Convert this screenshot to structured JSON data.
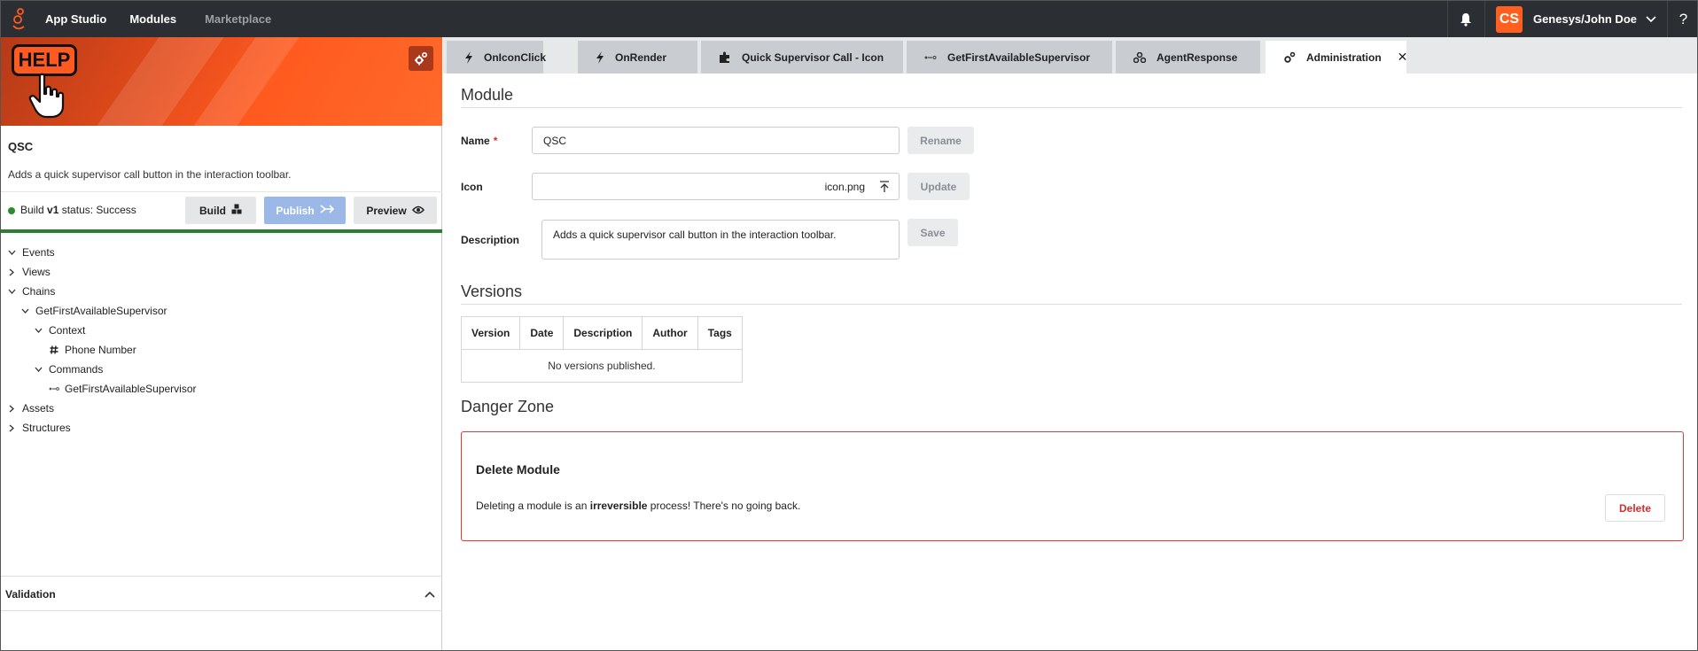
{
  "topnav": {
    "app_title": "App Studio",
    "modules": "Modules",
    "marketplace": "Marketplace",
    "avatar_initials": "CS",
    "user_name": "Genesys/John Doe",
    "help": "?"
  },
  "left": {
    "banner_text": "HELP",
    "module_name": "QSC",
    "module_description": "Adds a quick supervisor call button in the interaction toolbar.",
    "build_prefix": "Build ",
    "build_version": "v1",
    "build_suffix": " status: Success",
    "build_button": "Build",
    "publish_button": "Publish",
    "preview_button": "Preview",
    "tree": {
      "events": "Events",
      "views": "Views",
      "chains": "Chains",
      "chain_name": "GetFirstAvailableSupervisor",
      "context": "Context",
      "phone": "Phone Number",
      "commands": "Commands",
      "command_name": "GetFirstAvailableSupervisor",
      "assets": "Assets",
      "structures": "Structures"
    },
    "validation": "Validation"
  },
  "tabs": [
    {
      "label": "OnIconClick"
    },
    {
      "label": "OnRender"
    },
    {
      "label": "Quick Supervisor Call - Icon"
    },
    {
      "label": "GetFirstAvailableSupervisor"
    },
    {
      "label": "AgentResponse"
    },
    {
      "label": "Administration"
    }
  ],
  "module_section": {
    "title": "Module",
    "name_label": "Name",
    "required_mark": "*",
    "name_value": "QSC",
    "rename": "Rename",
    "icon_label": "Icon",
    "icon_value": "icon.png",
    "update": "Update",
    "description_label": "Description",
    "description_value": "Adds a quick supervisor call button in the interaction toolbar.",
    "save": "Save"
  },
  "versions_section": {
    "title": "Versions",
    "columns": [
      "Version",
      "Date",
      "Description",
      "Author",
      "Tags"
    ],
    "empty": "No versions published."
  },
  "danger_section": {
    "title": "Danger Zone",
    "box_title": "Delete Module",
    "text_before": "Deleting a module is an ",
    "text_bold": "irreversible",
    "text_after": " process! There's no going back.",
    "delete": "Delete"
  },
  "colors": {
    "brand_orange": "#ff5a1f",
    "nav_dark": "#2b2f33",
    "success_green": "#2e7d32",
    "danger_red": "#e53935",
    "publish_blue": "#9bb8e6"
  }
}
